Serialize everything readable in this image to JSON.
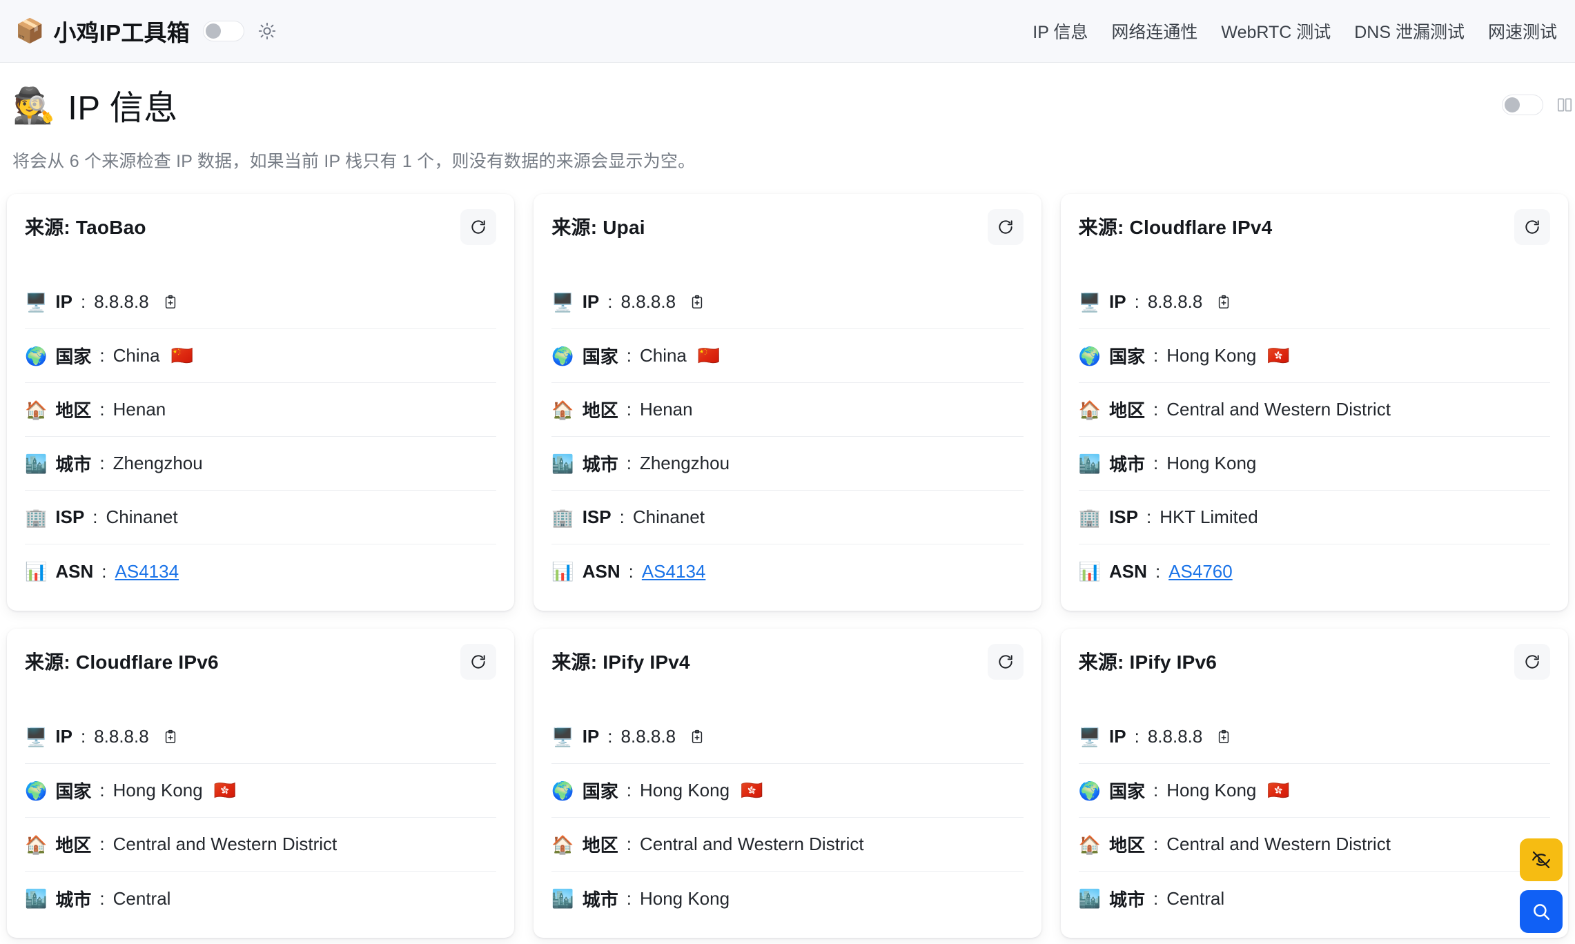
{
  "navbar": {
    "brand_icon": "package-icon",
    "brand_title": "小鸡IP工具箱",
    "theme_toggle": "off",
    "theme_icon": "sun-icon",
    "links": [
      {
        "label": "IP 信息"
      },
      {
        "label": "网络连通性"
      },
      {
        "label": "WebRTC 测试"
      },
      {
        "label": "DNS 泄漏测试"
      },
      {
        "label": "网速测试"
      }
    ]
  },
  "page": {
    "emoji": "🕵️",
    "title": "IP 信息",
    "subtitle": "将会从 6 个来源检查 IP 数据，如果当前 IP 栈只有 1 个，则没有数据的来源会显示为空。",
    "toggle_state": "off",
    "grid_icon": "columns-layout-icon"
  },
  "labels": {
    "source_prefix": "来源: ",
    "ip": "IP",
    "country": "国家",
    "region": "地区",
    "city": "城市",
    "isp": "ISP",
    "asn": "ASN",
    "colon": ": ",
    "refresh": "refresh-icon",
    "copy": "copy-to-clipboard-icon"
  },
  "cards": [
    {
      "source": "来源: TaoBao",
      "ip": "8.8.8.8",
      "country": "China",
      "flag": "🇨🇳",
      "region": "Henan",
      "city": "Zhengzhou",
      "isp": "Chinanet",
      "asn": "AS4134"
    },
    {
      "source": "来源: Upai",
      "ip": "8.8.8.8",
      "country": "China",
      "flag": "🇨🇳",
      "region": "Henan",
      "city": "Zhengzhou",
      "isp": "Chinanet",
      "asn": "AS4134"
    },
    {
      "source": "来源: Cloudflare IPv4",
      "ip": "8.8.8.8",
      "country": "Hong Kong",
      "flag": "🇭🇰",
      "region": "Central and Western District",
      "city": "Hong Kong",
      "isp": "HKT Limited",
      "asn": "AS4760"
    },
    {
      "source": "来源: Cloudflare IPv6",
      "ip": "8.8.8.8",
      "country": "Hong Kong",
      "flag": "🇭🇰",
      "region": "Central and Western District",
      "city": "Central",
      "isp": "",
      "asn": ""
    },
    {
      "source": "来源: IPify IPv4",
      "ip": "8.8.8.8",
      "country": "Hong Kong",
      "flag": "🇭🇰",
      "region": "Central and Western District",
      "city": "Hong Kong",
      "isp": "",
      "asn": ""
    },
    {
      "source": "来源: IPify IPv6",
      "ip": "8.8.8.8",
      "country": "Hong Kong",
      "flag": "🇭🇰",
      "region": "Central and Western District",
      "city": "Central",
      "isp": "",
      "asn": ""
    }
  ],
  "row_emojis": {
    "ip": "🖥️",
    "country": "🌍",
    "region": "🏠",
    "city": "🏙️",
    "isp": "🏢",
    "asn": "📊"
  },
  "fabs": [
    {
      "name": "eye-off-icon",
      "color": "#f6bc12"
    },
    {
      "name": "search-icon",
      "color": "#1060f5"
    }
  ],
  "colors": {
    "navbar_bg": "#f7f8fb",
    "card_bg": "#ffffff",
    "link_blue": "#1a73e8",
    "divider": "#eceef1",
    "fab_yellow": "#f6bc12",
    "fab_blue": "#1060f5"
  }
}
